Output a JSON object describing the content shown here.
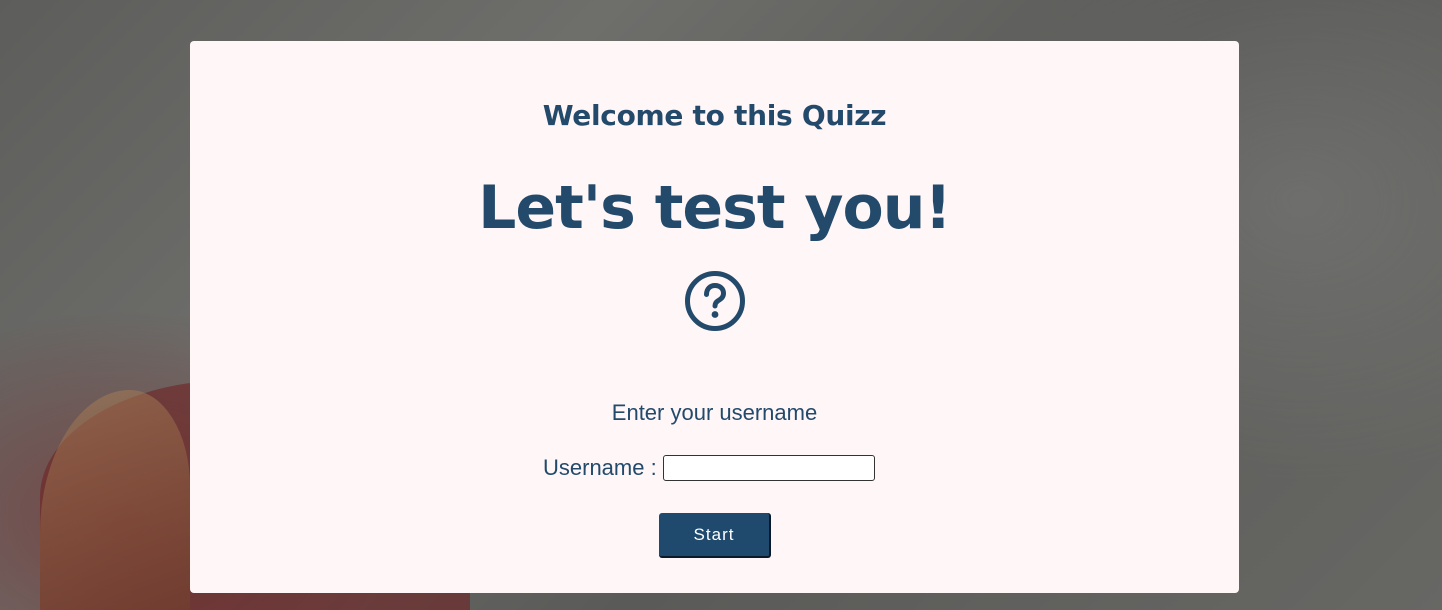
{
  "page": {
    "welcome": "Welcome to this Quizz",
    "headline": "Let's test you!",
    "icon": "question-circle-icon",
    "prompt": "Enter your username",
    "username_label": "Username :",
    "username_value": "",
    "start_label": "Start"
  },
  "colors": {
    "primary": "#234a6b",
    "button_bg": "#1f4a6e",
    "card_bg": "#fff6f7"
  }
}
